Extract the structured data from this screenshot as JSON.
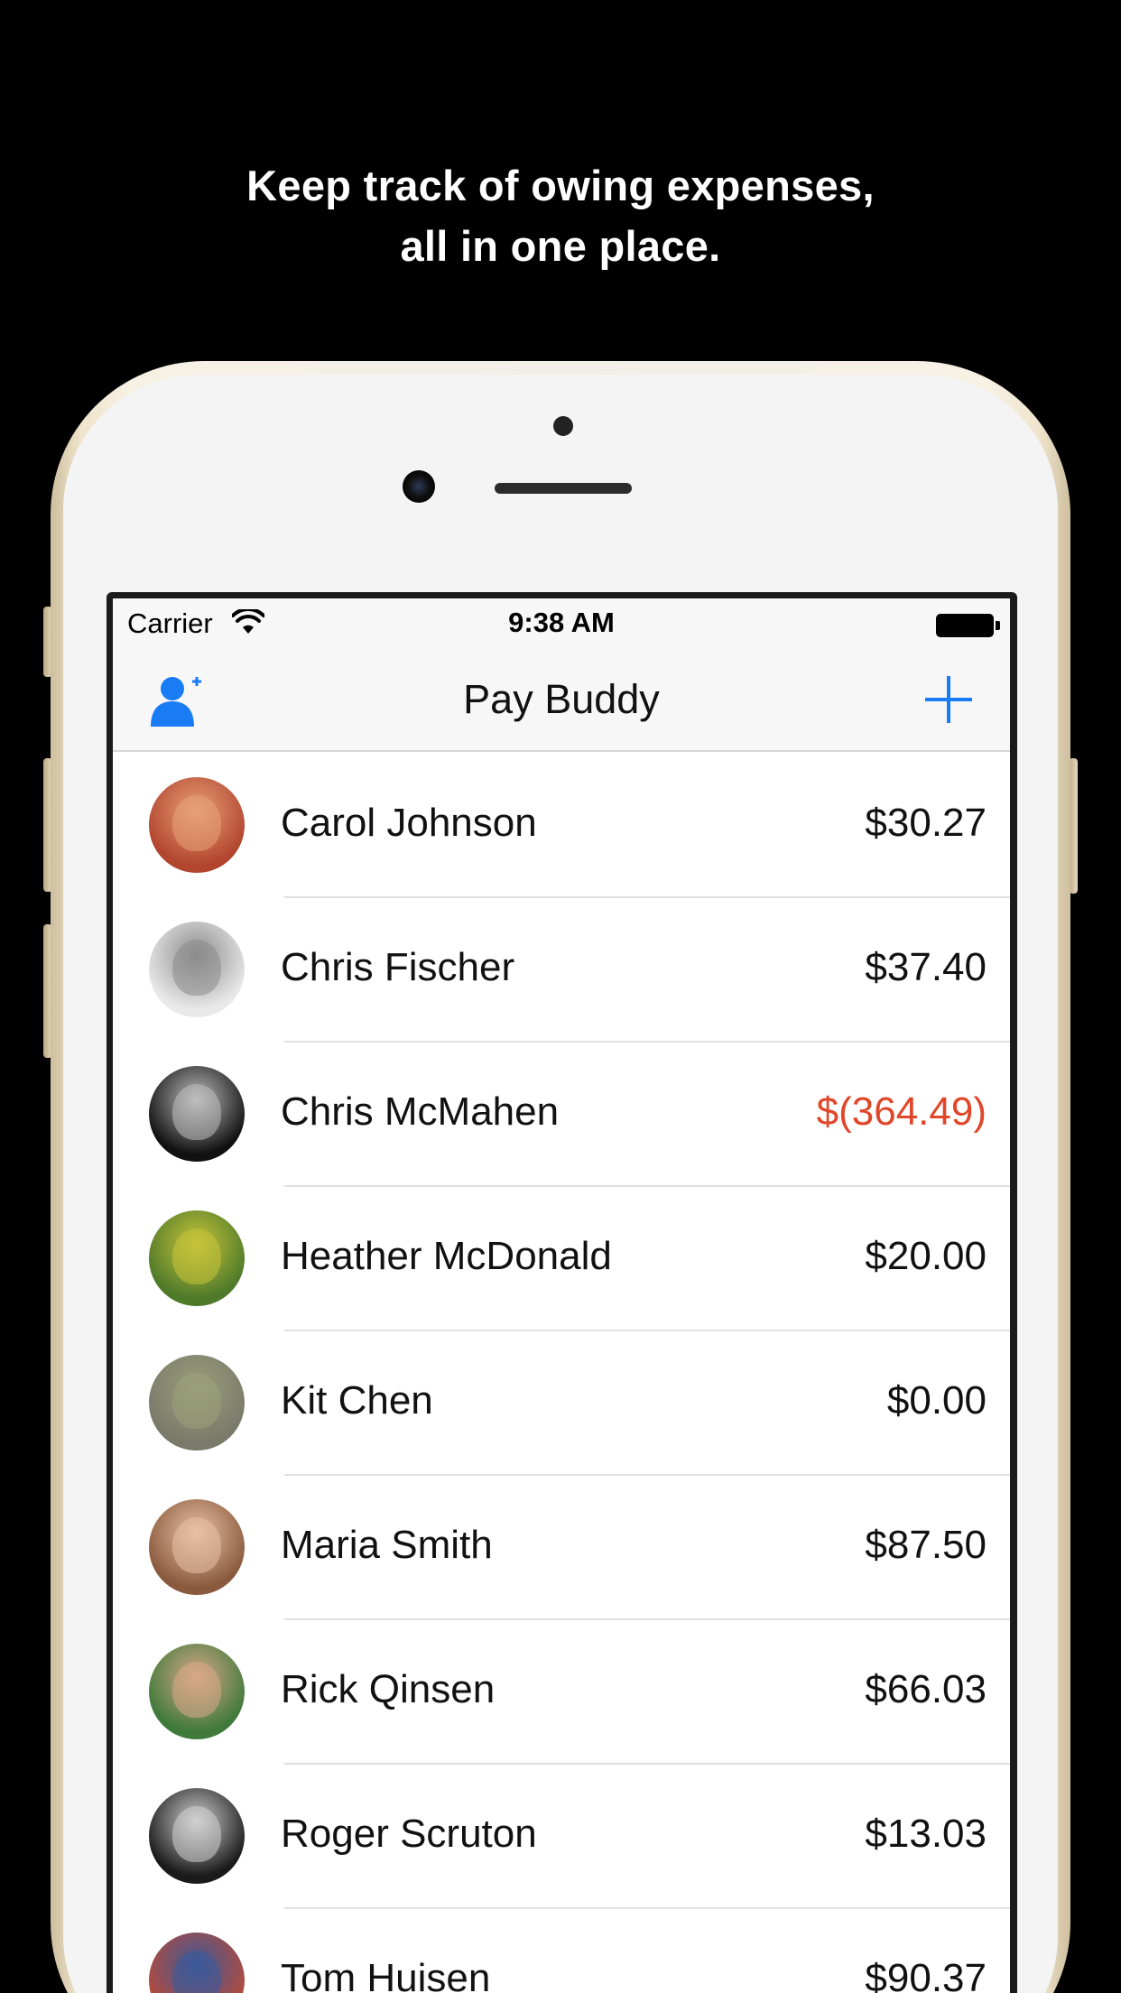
{
  "headline": {
    "line1": "Keep track of owing expenses,",
    "line2": "all in one place."
  },
  "status_bar": {
    "carrier": "Carrier",
    "time": "9:38 AM",
    "wifi_icon": "wifi-icon",
    "battery_icon": "battery-icon"
  },
  "nav": {
    "title": "Pay Buddy",
    "left_icon": "add-person-icon",
    "right_icon": "plus-icon",
    "accent": "#1a7cf5"
  },
  "contacts": [
    {
      "name": "Carol Johnson",
      "amount": "$30.27",
      "negative": false,
      "avatar_colors": [
        "#b2452e",
        "#e7a07a"
      ]
    },
    {
      "name": "Chris Fischer",
      "amount": "$37.40",
      "negative": false,
      "avatar_colors": [
        "#e9e9e9",
        "#8c8c8c"
      ]
    },
    {
      "name": "Chris McMahen",
      "amount": "$(364.49)",
      "negative": true,
      "avatar_colors": [
        "#111111",
        "#bdbdbd"
      ]
    },
    {
      "name": "Heather McDonald",
      "amount": "$20.00",
      "negative": false,
      "avatar_colors": [
        "#4e7a2a",
        "#c7c33a"
      ]
    },
    {
      "name": "Kit Chen",
      "amount": "$0.00",
      "negative": false,
      "avatar_colors": [
        "#7a7a6a",
        "#9aa07a"
      ]
    },
    {
      "name": "Maria Smith",
      "amount": "$87.50",
      "negative": false,
      "avatar_colors": [
        "#8a5a3e",
        "#e8c0a4"
      ]
    },
    {
      "name": "Rick Qinsen",
      "amount": "$66.03",
      "negative": false,
      "avatar_colors": [
        "#3f7a3a",
        "#d8a888"
      ]
    },
    {
      "name": "Roger Scruton",
      "amount": "$13.03",
      "negative": false,
      "avatar_colors": [
        "#1a1a1a",
        "#d0d0d0"
      ]
    },
    {
      "name": "Tom Huisen",
      "amount": "$90.37",
      "negative": false,
      "avatar_colors": [
        "#b84a3a",
        "#3a5a9a"
      ]
    }
  ],
  "colors": {
    "negative": "#e0462a",
    "background": "#000000"
  }
}
